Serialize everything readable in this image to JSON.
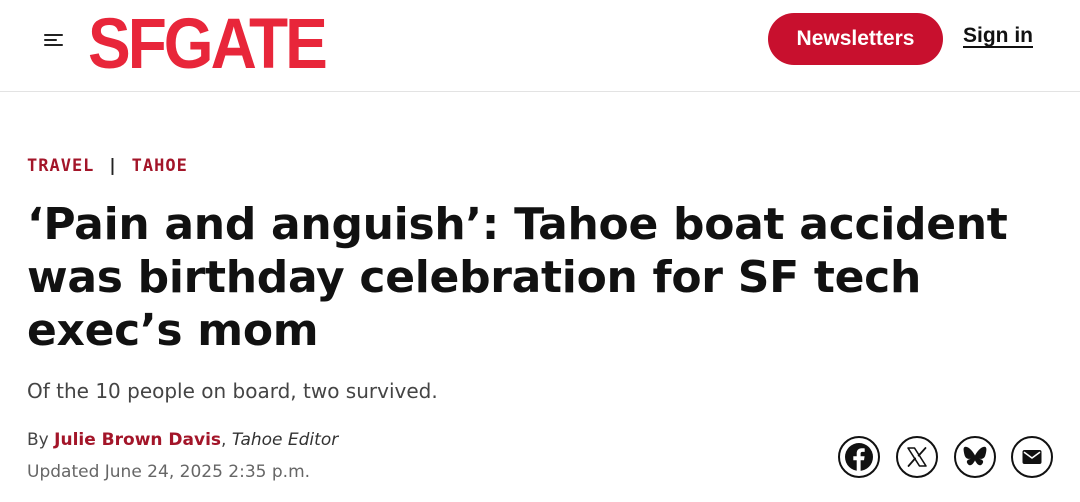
{
  "header": {
    "logo_text": "SFGATE",
    "newsletters_label": "Newsletters",
    "signin_label": "Sign in",
    "brand_color": "#e8263a",
    "button_color": "#c8102e"
  },
  "article": {
    "breadcrumbs": [
      "TRAVEL",
      "TAHOE"
    ],
    "breadcrumb_separator": "|",
    "headline": "‘Pain and anguish’: Tahoe boat accident was birthday celebration for SF tech exec’s mom",
    "dek": "Of the 10 people on board, two survived.",
    "byline_prefix": "By",
    "author": "Julie Brown Davis",
    "author_role": "Tahoe Editor",
    "updated": "Updated June 24, 2025 2:35 p.m.",
    "accent_color": "#a31529"
  },
  "share_icons": [
    "facebook-icon",
    "x-icon",
    "bluesky-icon",
    "email-icon"
  ]
}
